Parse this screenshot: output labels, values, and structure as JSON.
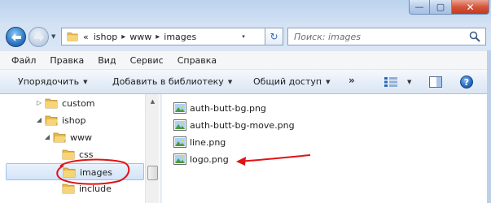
{
  "window": {
    "controls": {
      "minimize": "—",
      "maximize": "▢",
      "close": "✕"
    }
  },
  "address": {
    "history_chevron": "«",
    "separator": "▸",
    "breadcrumbs": [
      "ishop",
      "www",
      "images"
    ],
    "dropdown_caret": "▾",
    "refresh_glyph": "↻"
  },
  "search": {
    "placeholder": "Поиск: images"
  },
  "menu": {
    "items": [
      "Файл",
      "Правка",
      "Вид",
      "Сервис",
      "Справка"
    ]
  },
  "toolbar": {
    "organize": "Упорядочить",
    "add_to_library": "Добавить в библиотеку",
    "share": "Общий доступ",
    "more": "»",
    "caret": "▼",
    "help": "?"
  },
  "navigation": {
    "tree": [
      {
        "label": "custom",
        "arrow": "▷",
        "selected": false
      },
      {
        "label": "ishop",
        "arrow": "◢",
        "selected": false
      },
      {
        "label": "www",
        "arrow": "◢",
        "selected": false
      },
      {
        "label": "css",
        "arrow": "",
        "selected": false
      },
      {
        "label": "images",
        "arrow": "",
        "selected": true
      },
      {
        "label": "include",
        "arrow": "",
        "selected": false
      }
    ],
    "scroll_up": "▲"
  },
  "files": [
    {
      "name": "auth-butt-bg.png"
    },
    {
      "name": "auth-butt-bg-move.png"
    },
    {
      "name": "line.png"
    },
    {
      "name": "logo.png"
    }
  ],
  "annotation_color": "#e01313",
  "accent_colors": {
    "folder": "#e8b948",
    "selection": "#d3e4f9"
  }
}
